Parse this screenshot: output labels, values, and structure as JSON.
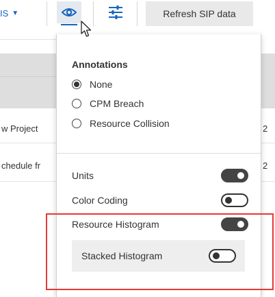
{
  "toolbar": {
    "dropdown_fragment": "IS",
    "view_icon": "eye-icon",
    "settings_icon": "sliders-icon",
    "refresh_label": "Refresh SIP data"
  },
  "grid": {
    "rows": [
      {
        "left_text": "w Project",
        "right_text": "2"
      },
      {
        "left_text": "chedule fr",
        "right_text": "2"
      }
    ]
  },
  "popup": {
    "annotations": {
      "title": "Annotations",
      "options": [
        {
          "label": "None",
          "checked": true
        },
        {
          "label": "CPM Breach",
          "checked": false
        },
        {
          "label": "Resource Collision",
          "checked": false
        }
      ]
    },
    "toggles": {
      "units": {
        "label": "Units",
        "on": true
      },
      "color_coding": {
        "label": "Color Coding",
        "on": false
      },
      "resource_histogram": {
        "label": "Resource Histogram",
        "on": true
      },
      "stacked_histogram": {
        "label": "Stacked Histogram",
        "on": false
      }
    }
  },
  "colors": {
    "accent": "#1565c0",
    "highlight": "#e53935",
    "toggle_on": "#444444"
  }
}
